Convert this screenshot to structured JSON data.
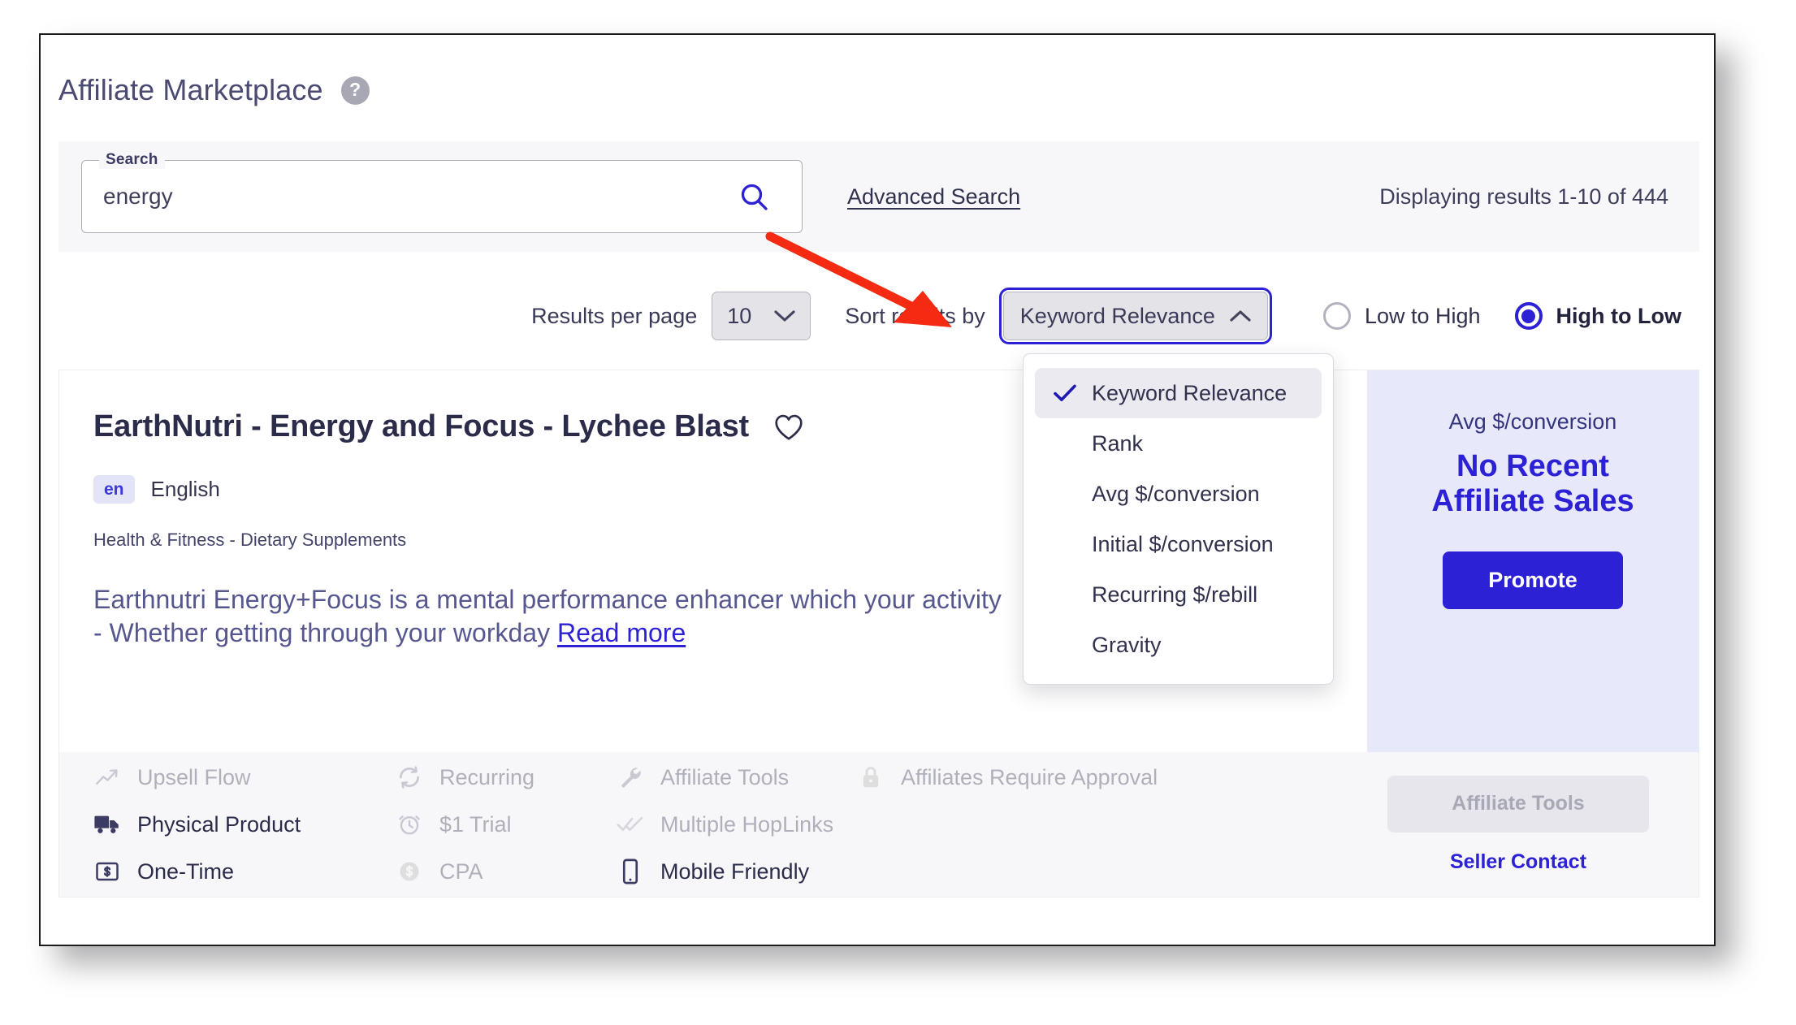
{
  "header": {
    "title": "Affiliate Marketplace",
    "help_icon": "question-mark-icon",
    "help_label": "?"
  },
  "search": {
    "legend": "Search",
    "value": "energy",
    "placeholder": "Search",
    "search_icon": "magnifier-icon",
    "advanced_link": "Advanced Search",
    "results_count": "Displaying results 1-10 of 444"
  },
  "controls": {
    "per_page_label": "Results per page",
    "per_page_value": "10",
    "sort_label": "Sort results by",
    "sort_value": "Keyword Relevance",
    "sort_open": true,
    "order_low_to_high": "Low to High",
    "order_high_to_low": "High to Low",
    "selected_order": "High to Low"
  },
  "sort_menu": {
    "items": [
      {
        "label": "Keyword Relevance",
        "checked": true
      },
      {
        "label": "Rank",
        "checked": false
      },
      {
        "label": "Avg $/conversion",
        "checked": false
      },
      {
        "label": "Initial $/conversion",
        "checked": false
      },
      {
        "label": "Recurring $/rebill",
        "checked": false
      },
      {
        "label": "Gravity",
        "checked": false
      }
    ]
  },
  "result": {
    "title": "EarthNutri - Energy and Focus - Lychee Blast",
    "favorite_icon": "heart-icon",
    "lang_code": "en",
    "lang_name": "English",
    "category": "Health & Fitness - Dietary Supplements",
    "description": "Earthnutri Energy+Focus is a mental performance enhancer which your activity - Whether getting through your workday ",
    "read_more": "Read more",
    "promo": {
      "metric_label": "Avg $/conversion",
      "metric_value": "No Recent Affiliate Sales",
      "metric_value_line1": "No Recent",
      "metric_value_line2": "Affiliate Sales",
      "button": "Promote"
    },
    "attributes": [
      {
        "label": "Upsell Flow",
        "icon": "trend-up-icon",
        "enabled": false
      },
      {
        "label": "Physical Product",
        "icon": "truck-icon",
        "enabled": true
      },
      {
        "label": "One-Time",
        "icon": "dollar-box-icon",
        "enabled": true
      },
      {
        "label": "Recurring",
        "icon": "refresh-icon",
        "enabled": false
      },
      {
        "label": "$1 Trial",
        "icon": "alarm-clock-icon",
        "enabled": false
      },
      {
        "label": "CPA",
        "icon": "dollar-circle-icon",
        "enabled": false
      },
      {
        "label": "Affiliate Tools",
        "icon": "wrench-icon",
        "enabled": false
      },
      {
        "label": "Multiple HopLinks",
        "icon": "double-check-icon",
        "enabled": false
      },
      {
        "label": "Mobile Friendly",
        "icon": "mobile-phone-icon",
        "enabled": true
      },
      {
        "label": "Affiliates Require Approval",
        "icon": "lock-icon",
        "enabled": false
      }
    ],
    "actions": {
      "affiliate_tools_button": "Affiliate Tools",
      "seller_contact_link": "Seller Contact"
    }
  },
  "annotation": {
    "arrow_color": "#f52a12",
    "arrow_name": "red-annotation-arrow"
  },
  "colors": {
    "accent": "#2d21d6",
    "title": "#4b4a72",
    "muted": "#b0b0ba",
    "panel_bg": "#f7f7fa",
    "promo_bg": "#e7e8fa"
  }
}
